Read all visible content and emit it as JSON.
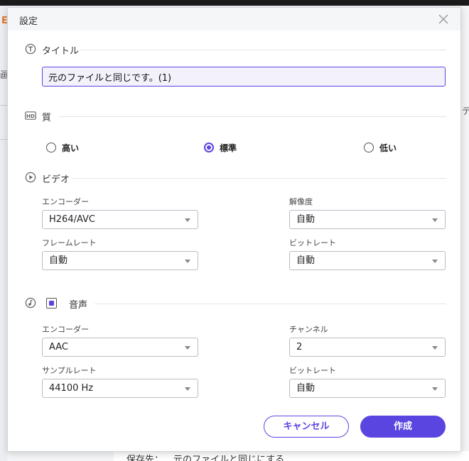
{
  "background": {
    "fragment_top_left": "E",
    "fragment_left": "画",
    "fragment_right": "デ",
    "bottom_label": "保存先：",
    "bottom_value": "元のファイルと同じにする"
  },
  "dialog": {
    "title": "設定",
    "close_icon": "close-icon"
  },
  "sections": {
    "title_label": "タイトル",
    "quality_label": "質",
    "video_label": "ビデオ",
    "audio_label": "音声"
  },
  "title_input": {
    "value": "元のファイルと同じです。(1)"
  },
  "quality": {
    "options": [
      "高い",
      "標準",
      "低い"
    ],
    "selected": "標準"
  },
  "video": {
    "encoder_label": "エンコーダー",
    "encoder_value": "H264/AVC",
    "resolution_label": "解像度",
    "resolution_value": "自動",
    "framerate_label": "フレームレート",
    "framerate_value": "自動",
    "bitrate_label": "ビットレート",
    "bitrate_value": "自動"
  },
  "audio": {
    "enabled": true,
    "encoder_label": "エンコーダー",
    "encoder_value": "AAC",
    "channel_label": "チャンネル",
    "channel_value": "2",
    "samplerate_label": "サンプルレート",
    "samplerate_value": "44100 Hz",
    "bitrate_label": "ビットレート",
    "bitrate_value": "自動"
  },
  "buttons": {
    "cancel": "キャンセル",
    "create": "作成"
  },
  "colors": {
    "accent": "#5a45e0",
    "input_bg": "#f3f2fc"
  }
}
